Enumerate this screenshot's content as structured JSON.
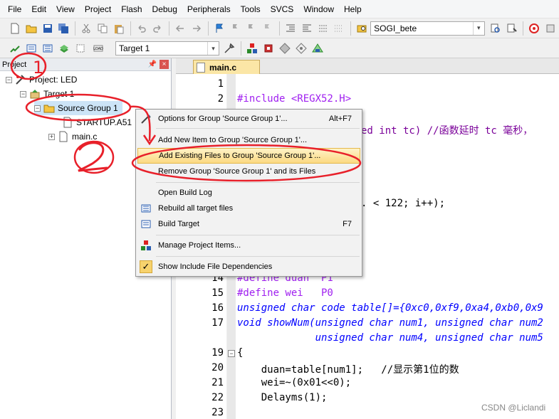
{
  "menubar": [
    "File",
    "Edit",
    "View",
    "Project",
    "Flash",
    "Debug",
    "Peripherals",
    "Tools",
    "SVCS",
    "Window",
    "Help"
  ],
  "toolbar1": {
    "target_combo": "SOGI_bete"
  },
  "toolbar2": {
    "target_combo": "Target 1"
  },
  "project_panel": {
    "title": "Project",
    "tree": {
      "project": "Project: LED",
      "target": "Target 1",
      "group": "Source Group 1",
      "files": [
        "STARTUP.A51",
        "main.c"
      ]
    }
  },
  "editor": {
    "tab": "main.c",
    "line_numbers": [
      1,
      2,
      14,
      15,
      16,
      17,
      19,
      20,
      21,
      22,
      23
    ],
    "code": {
      "l2": "#include <REGX52.H>",
      "l4_frag": "ed int tc) //函数延时 tc 毫秒，",
      "l8_frag": ". < 122; i++);",
      "l14": "#define duan  P1",
      "l15": "#define wei   P0",
      "l16": "unsigned char code table[]={0xc0,0xf9,0xa4,0xb0,0x9",
      "l17": "void showNum(unsigned char num1, unsigned char num2",
      "l18": "             unsigned char num4, unsigned char num5",
      "l19": "{",
      "l20": "    duan=table[num1];   //显示第1位的数",
      "l21": "    wei=~(0x01<<0);",
      "l22": "    Delayms(1);"
    }
  },
  "context_menu": {
    "items": [
      {
        "label": "Options for Group 'Source Group 1'...",
        "shortcut": "Alt+F7"
      },
      {
        "label": "Add New  Item to Group 'Source Group 1'...",
        "shortcut": ""
      },
      {
        "label": "Add Existing Files to Group 'Source Group 1'...",
        "shortcut": ""
      },
      {
        "label": "Remove Group 'Source Group 1' and its Files",
        "shortcut": ""
      },
      {
        "label": "Open Build Log",
        "shortcut": ""
      },
      {
        "label": "Rebuild all target files",
        "shortcut": ""
      },
      {
        "label": "Build Target",
        "shortcut": "F7"
      },
      {
        "label": "Manage Project Items...",
        "shortcut": ""
      },
      {
        "label": "Show Include File Dependencies",
        "shortcut": ""
      }
    ]
  },
  "annotations": {
    "mark1": "1",
    "mark2": "2"
  },
  "watermark": "CSDN @Liclandi",
  "colors": {
    "annotation_red": "#e8202a",
    "highlight": "#fbd982",
    "tab_active": "#fbe6a6"
  }
}
